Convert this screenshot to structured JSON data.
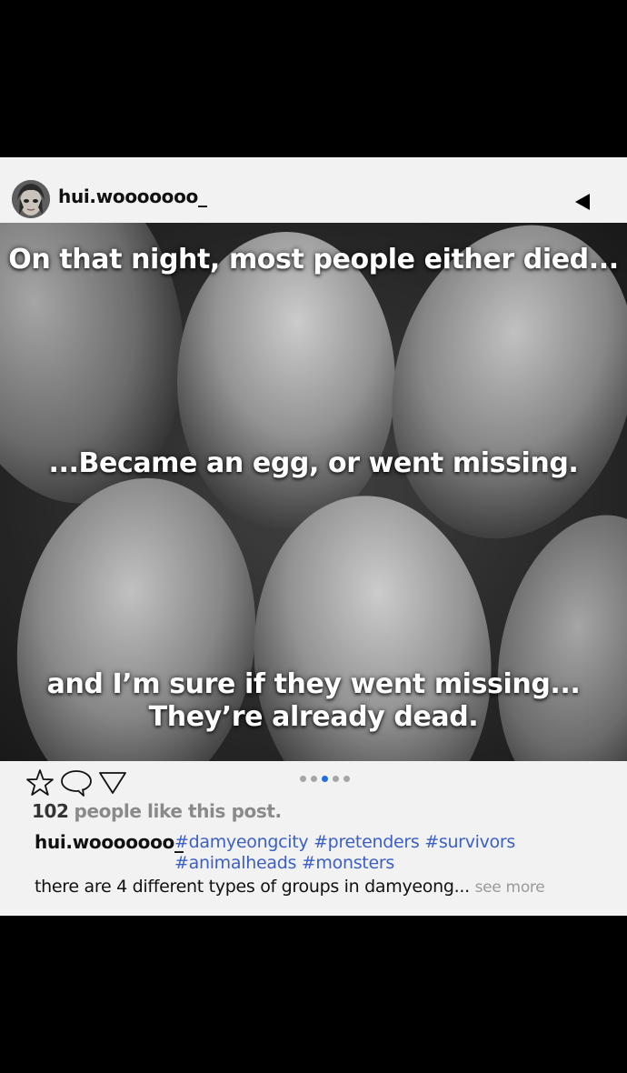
{
  "post": {
    "username": "hui.wooooooo_",
    "avatar_icon": "profile-avatar",
    "back_icon": "left-triangle-icon",
    "image": {
      "description_icon": "eggs-photo",
      "captions": [
        "On that night, most people either died...",
        "...Became an egg, or went missing.",
        "and I’m sure if they went missing...",
        "They’re already dead."
      ]
    },
    "actions": {
      "like_icon": "star-icon",
      "comment_icon": "speech-bubble-icon",
      "share_icon": "triangle-down-icon"
    },
    "carousel": {
      "total": 5,
      "active_index": 3
    },
    "likes": {
      "count": "102",
      "text": "people like this post."
    },
    "caption": {
      "username": "hui.wooooooo_",
      "hashtags": [
        "#damyeongcity",
        "#pretenders",
        "#survivors",
        "#animalheads",
        "#monsters"
      ],
      "text": "there are 4 different types of groups in damyeong...",
      "see_more": "see more"
    }
  }
}
